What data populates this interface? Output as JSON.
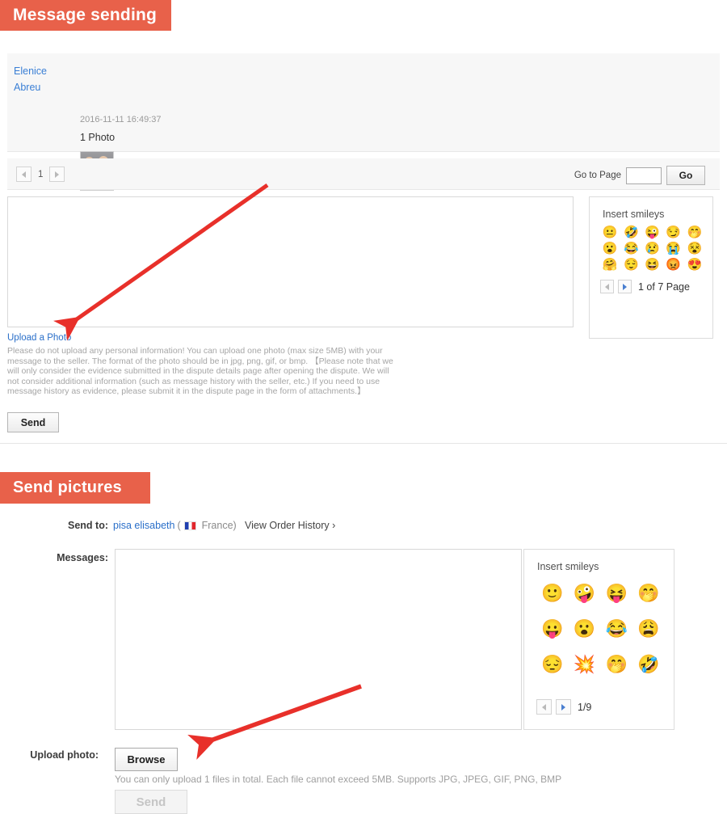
{
  "sections": {
    "message_sending": {
      "banner_title": "Message sending",
      "thread": {
        "sender_line1": "Elenice",
        "sender_line2": "Abreu",
        "timestamp": "2016-11-11 16:49:37",
        "body": "1 Photo",
        "attachment_alt": "photo-thumbnail"
      },
      "pager": {
        "prev_icon": "chevron-left-icon",
        "current_page": "1",
        "next_icon": "chevron-right-icon",
        "goto_label": "Go to Page",
        "goto_value": "",
        "goto_placeholder": "",
        "go_label": "Go"
      },
      "compose": {
        "textarea_value": "",
        "textarea_placeholder": ""
      },
      "smileys": {
        "title": "Insert smileys",
        "items": [
          "😐",
          "🤣",
          "😜",
          "😏",
          "🤭",
          "😮",
          "😂",
          "😢",
          "😭",
          "😵",
          "🤗",
          "😌",
          "😆",
          "😡",
          "😍"
        ],
        "prev_icon": "chevron-left-icon",
        "next_icon": "chevron-right-icon",
        "page_text": "1 of 7 Page"
      },
      "upload_link": "Upload a Photo",
      "notice": "Please do not upload any personal information! You can upload one photo (max size 5MB) with your message to the seller. The format of the photo should be in jpg, png, gif, or bmp.\n【Please note that we will only consider the evidence submitted in the dispute details page after opening the dispute. We will not consider additional information (such as message history with the seller, etc.) If you need to use message history as evidence, please submit it in the dispute page in the form of attachments.】",
      "send_label": "Send"
    },
    "send_pictures": {
      "banner_title": "Send pictures",
      "send_to_label": "Send to:",
      "recipient_name": "pisa elisabeth",
      "recipient_open_paren": "(",
      "recipient_flag": "france-flag-icon",
      "recipient_country": "France)",
      "order_history_link": "View Order History ›",
      "messages_label": "Messages:",
      "compose": {
        "textarea_value": "",
        "textarea_placeholder": ""
      },
      "smileys": {
        "title": "Insert smileys",
        "items": [
          "🙂",
          "🤪",
          "😝",
          "🤭",
          "😛",
          "😮",
          "😂",
          "😩",
          "😔",
          "💥",
          "🤭",
          "🤣"
        ],
        "prev_icon": "chevron-left-icon",
        "next_icon": "chevron-right-icon",
        "page_text": "1/9"
      },
      "upload_photo_label": "Upload photo:",
      "browse_label": "Browse",
      "upload_note": "You can only upload 1 files in total. Each file cannot exceed 5MB. Supports JPG, JPEG, GIF, PNG, BMP",
      "send_label": "Send"
    }
  },
  "annotations": {
    "arrow_color": "#e8302a",
    "arrow_1_target": "Upload a Photo",
    "arrow_2_target": "Browse"
  },
  "colors": {
    "banner_orange": "#e8614a",
    "link_blue": "#2a6fc9",
    "panel_grey": "#f7f7f7",
    "arrow_red": "#e8302a"
  }
}
